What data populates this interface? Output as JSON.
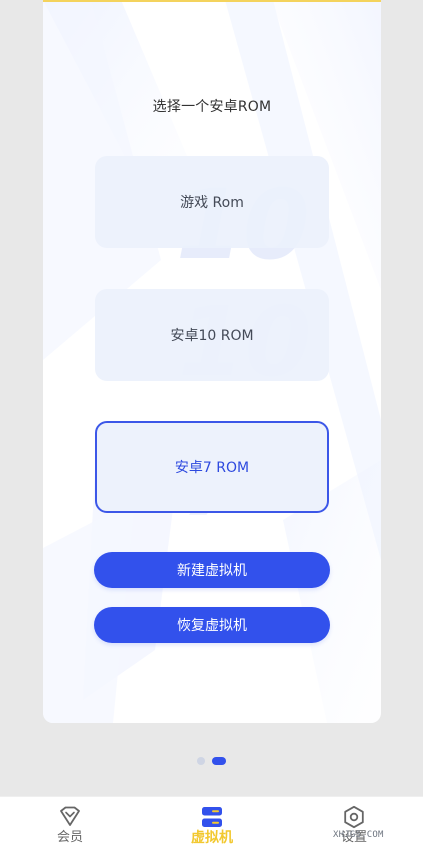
{
  "card": {
    "title": "选择一个安卓ROM"
  },
  "rom_options": [
    {
      "label": "游戏 Rom",
      "selected": false
    },
    {
      "label": "安卓10 ROM",
      "selected": false
    },
    {
      "label": "安卓7 ROM",
      "selected": true
    }
  ],
  "actions": {
    "new_vm": "新建虚拟机",
    "restore_vm": "恢复虚拟机"
  },
  "pager": {
    "total": 2,
    "active": 2
  },
  "nav": {
    "member": "会员",
    "vm": "虚拟机",
    "settings": "设置"
  },
  "watermark": "XHJGS.COM",
  "colors": {
    "accent": "#3251ec",
    "selected_border": "#3c57e8",
    "nav_active": "#f2c82f",
    "background": "#e8e8e8"
  }
}
